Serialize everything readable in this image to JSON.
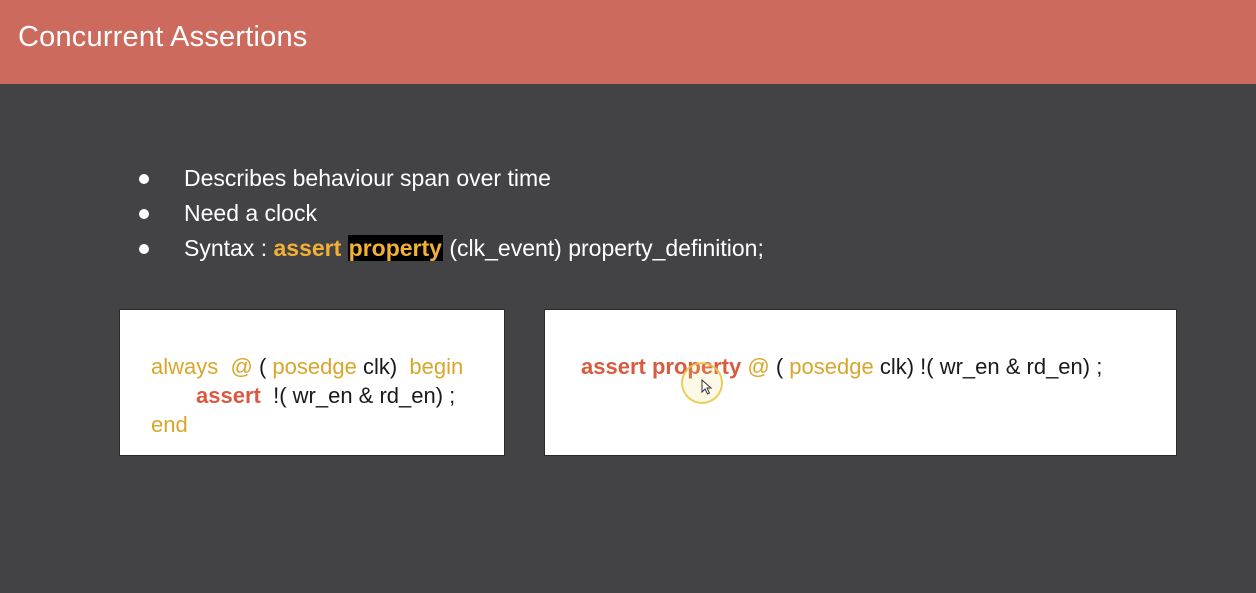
{
  "header": {
    "title": "Concurrent Assertions"
  },
  "bullets": {
    "item1": "Describes behaviour span over time",
    "item2": "Need a clock",
    "item3": {
      "prefix": "Syntax : ",
      "kw_assert": "assert",
      "kw_property": "property",
      "suffix": " (clk_event) property_definition;"
    }
  },
  "left_code": {
    "line1": {
      "always": "always",
      "at": "@",
      "open": "(",
      "posedge": "posedge",
      "clk": "clk)",
      "begin": "begin"
    },
    "line2": {
      "assert": "assert",
      "expr": "!( wr_en & rd_en) ;"
    },
    "line3": {
      "end": "end"
    }
  },
  "right_code": {
    "assert": "assert",
    "property": "property",
    "at": "@",
    "open": "(",
    "posedge": "posedge",
    "rest": "clk) !( wr_en & rd_en) ;"
  },
  "colors": {
    "title_bar": "#cd6a5e",
    "background": "#434345",
    "keyword_orange": "#d9a62b",
    "keyword_red": "#d95a40",
    "syntax_yellow": "#f2b134"
  },
  "icons": {
    "cursor": "mouse-pointer-icon",
    "click_highlight": "click-highlight-ring"
  }
}
